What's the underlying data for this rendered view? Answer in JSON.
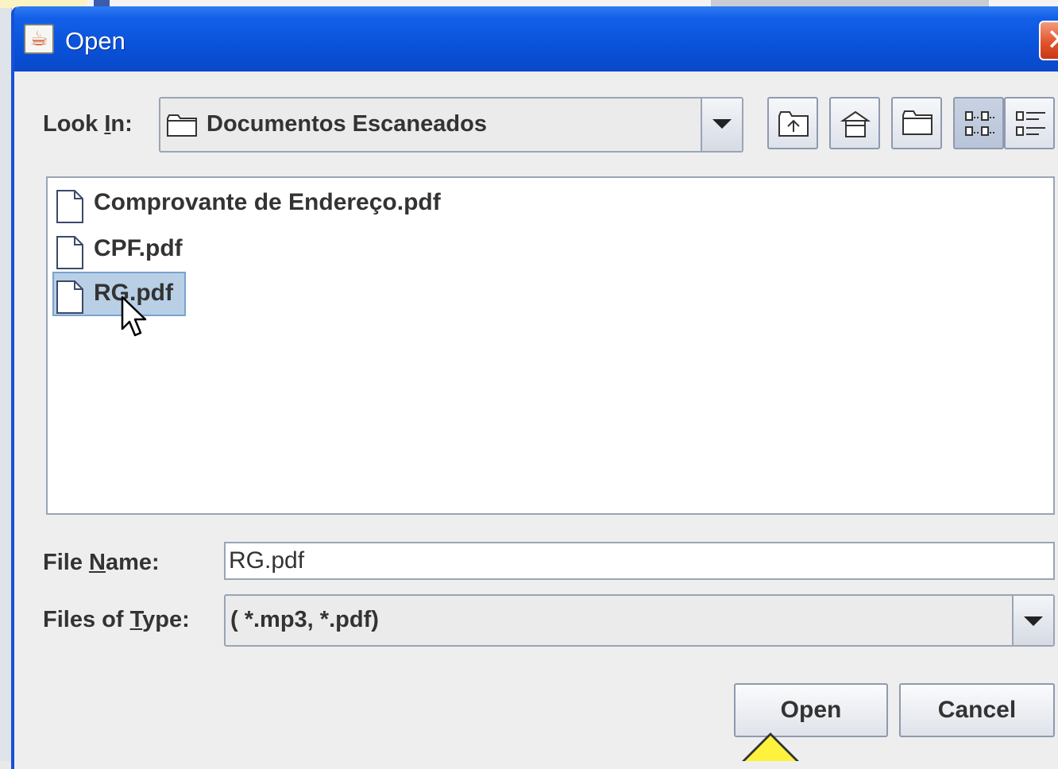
{
  "window": {
    "title": "Open",
    "close_label": "✕"
  },
  "look_in": {
    "label_pre": "Look ",
    "label_mnemonic": "I",
    "label_post": "n:",
    "value": "Documentos Escaneados"
  },
  "toolbar": {
    "buttons": [
      {
        "name": "up-one-level-icon"
      },
      {
        "name": "home-icon"
      },
      {
        "name": "new-folder-icon"
      },
      {
        "name": "list-view-icon",
        "pressed": true
      },
      {
        "name": "details-view-icon"
      }
    ]
  },
  "files": [
    {
      "name": "Comprovante de Endereço.pdf",
      "selected": false
    },
    {
      "name": "CPF.pdf",
      "selected": false
    },
    {
      "name": "RG.pdf",
      "selected": true
    }
  ],
  "file_name": {
    "label_pre": "File ",
    "label_mnemonic": "N",
    "label_post": "ame:",
    "value": "RG.pdf"
  },
  "files_of_type": {
    "label_pre": "Files of ",
    "label_mnemonic": "T",
    "label_post": "ype:",
    "value": "( *.mp3, *.pdf)"
  },
  "buttons": {
    "open": "Open",
    "cancel": "Cancel"
  },
  "colors": {
    "titlebar": "#0a52da",
    "selection": "#b8cfe5",
    "close": "#e2542c"
  }
}
